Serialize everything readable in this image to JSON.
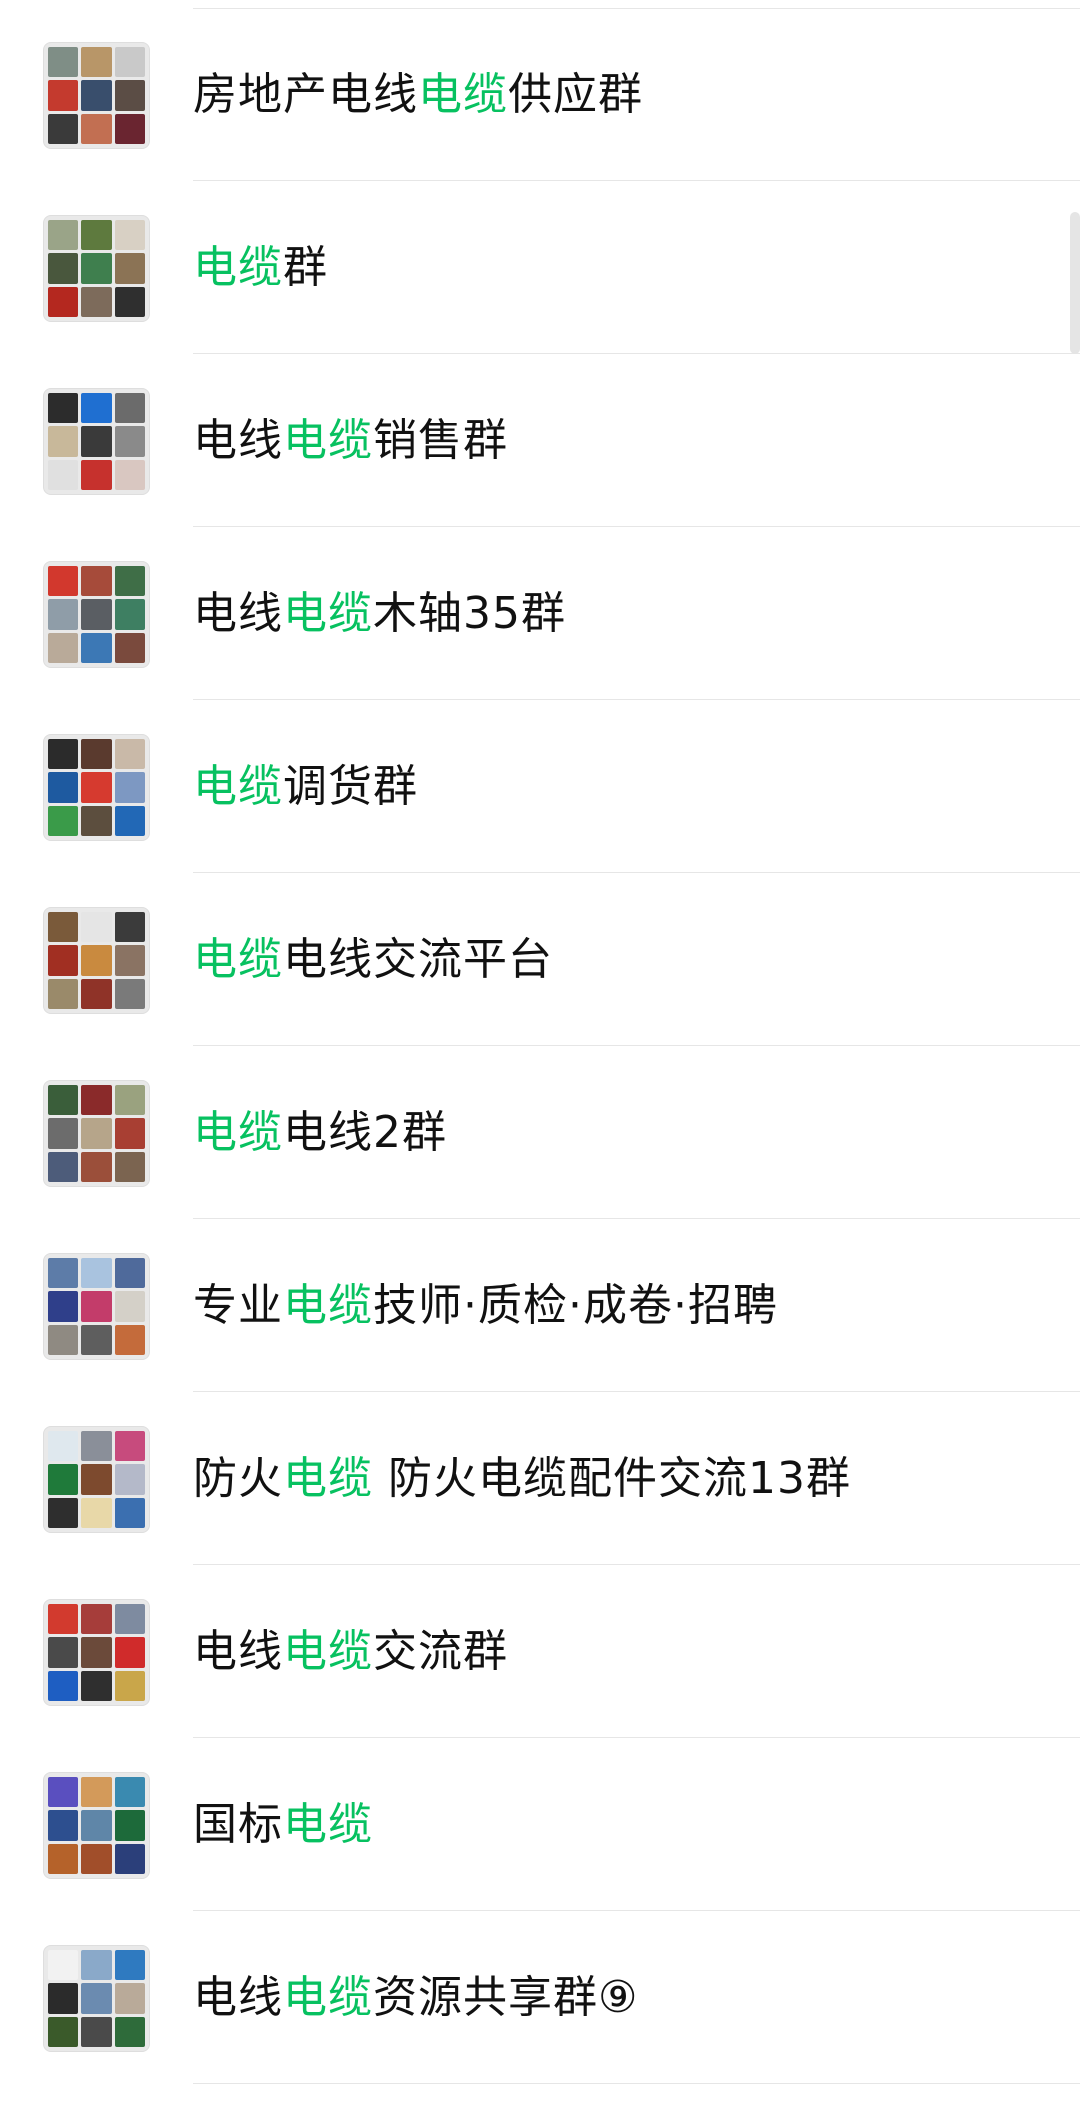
{
  "groups": [
    {
      "name_parts": [
        "房地产电线",
        "电缆",
        "供应群"
      ],
      "tiles": [
        "#7f8e86",
        "#b89668",
        "#c9c9c9",
        "#c43a2e",
        "#394e6c",
        "#5b4d45",
        "#3a3a3a",
        "#c26f52",
        "#6a2530"
      ]
    },
    {
      "name_parts": [
        "",
        "电缆",
        "群"
      ],
      "tiles": [
        "#9aa488",
        "#5e7a3e",
        "#d8d0c4",
        "#49573d",
        "#3f7f4e",
        "#8b7355",
        "#b4281f",
        "#7d6b5b",
        "#2f2f2f"
      ]
    },
    {
      "name_parts": [
        "电线",
        "电缆",
        "销售群"
      ],
      "tiles": [
        "#2c2c2c",
        "#1f6fd1",
        "#6b6b6b",
        "#c8b89a",
        "#3a3a3a",
        "#8a8a8a",
        "#e0e0e0",
        "#c6312d",
        "#d9c7c1"
      ]
    },
    {
      "name_parts": [
        "电线",
        "电缆",
        "木轴35群"
      ],
      "tiles": [
        "#d2382d",
        "#a64b3a",
        "#3f6e47",
        "#8f9da8",
        "#5a5e63",
        "#3e7f62",
        "#b9aa99",
        "#3c78b5",
        "#7a4a3d"
      ]
    },
    {
      "name_parts": [
        "",
        "电缆",
        "调货群"
      ],
      "tiles": [
        "#2b2b2b",
        "#5a3a2e",
        "#c9b9a8",
        "#1e5aa0",
        "#d63a2f",
        "#7d98c2",
        "#3a9b49",
        "#5c4e3e",
        "#2268b6"
      ]
    },
    {
      "name_parts": [
        "",
        "电缆",
        "电线交流平台"
      ],
      "tiles": [
        "#7a5a3a",
        "#e5e5e5",
        "#3b3b3b",
        "#a12f22",
        "#c98a3f",
        "#8a7363",
        "#9a8a6a",
        "#8f3328",
        "#7a7a7a"
      ]
    },
    {
      "name_parts": [
        "",
        "电缆",
        "电线2群"
      ],
      "tiles": [
        "#3a5e3a",
        "#8a2a2a",
        "#9aa27f",
        "#6c6c6c",
        "#b6a58a",
        "#a83f33",
        "#4d5c7a",
        "#9b4f3a",
        "#7b6450"
      ]
    },
    {
      "name_parts": [
        "专业",
        "电缆",
        "技师·质检·成卷·招聘"
      ],
      "tiles": [
        "#5d7ca8",
        "#a9c3df",
        "#4f6a9b",
        "#2f3f8a",
        "#c33c6a",
        "#d4d0c8",
        "#8f8a82",
        "#5e5e5e",
        "#c46b3b"
      ]
    },
    {
      "name_parts": [
        "防火",
        "电缆",
        " 防火电缆配件交流13群"
      ],
      "tiles": [
        "#dfe8ee",
        "#8a8f99",
        "#c74b7d",
        "#1f7a3a",
        "#7d4a2e",
        "#b4b9c9",
        "#2e2e2e",
        "#e8d8a8",
        "#3b6fb0"
      ]
    },
    {
      "name_parts": [
        "电线",
        "电缆",
        "交流群"
      ],
      "tiles": [
        "#d23a2e",
        "#a63d3a",
        "#7e8ba0",
        "#4a4a4a",
        "#6b4a3a",
        "#d02b2b",
        "#1e5ec2",
        "#2f2f2f",
        "#c9a64a"
      ]
    },
    {
      "name_parts": [
        "国标",
        "电缆",
        ""
      ],
      "tiles": [
        "#5a4fbf",
        "#d39a5a",
        "#3a8ab0",
        "#2d4f8f",
        "#5f86a8",
        "#1d6a3a",
        "#b5622a",
        "#a14e2a",
        "#2b3f7a"
      ]
    },
    {
      "name_parts": [
        "电线",
        "电缆",
        "资源共享群⑨"
      ],
      "tiles": [
        "#f2f2f2",
        "#8aa9c9",
        "#2f7ac0",
        "#2b2b2b",
        "#6b8bb0",
        "#b9aa99",
        "#3a5a2a",
        "#4a4a4a",
        "#2e6b3a"
      ]
    }
  ]
}
